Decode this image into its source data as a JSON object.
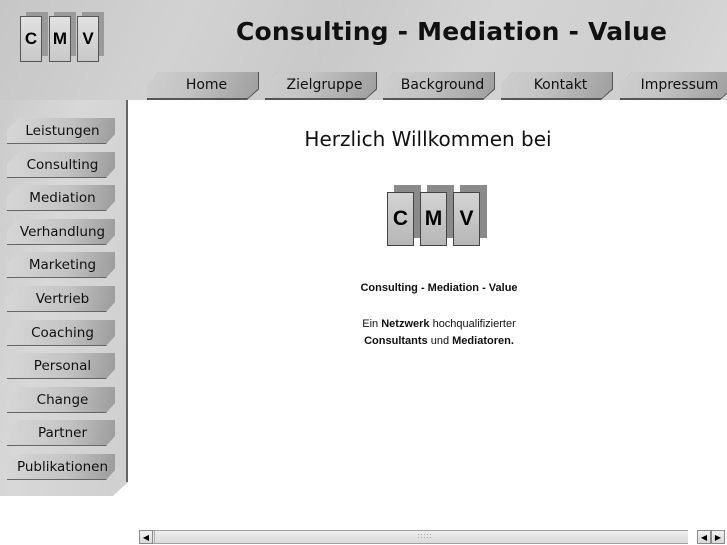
{
  "header": {
    "logo_letters": [
      "C",
      "M",
      "V"
    ],
    "title": "Consulting - Mediation - Value"
  },
  "top_nav": {
    "tabs": [
      {
        "label": "Home"
      },
      {
        "label": "Zielgruppe"
      },
      {
        "label": "Background"
      },
      {
        "label": "Kontakt"
      },
      {
        "label": "Impressum"
      }
    ]
  },
  "sidebar": {
    "items": [
      {
        "label": "Leistungen"
      },
      {
        "label": "Consulting"
      },
      {
        "label": "Mediation"
      },
      {
        "label": "Verhandlung"
      },
      {
        "label": "Marketing"
      },
      {
        "label": "Vertrieb"
      },
      {
        "label": "Coaching"
      },
      {
        "label": "Personal"
      },
      {
        "label": "Change"
      },
      {
        "label": "Partner"
      },
      {
        "label": "Publikationen"
      }
    ]
  },
  "main": {
    "welcome": "Herzlich Willkommen bei",
    "logo_letters": [
      "C",
      "M",
      "V"
    ],
    "tagline": "Consulting - Mediation - Value",
    "desc": {
      "part1": "Ein ",
      "bold1": "Netzwerk",
      "part2": " hochqualifizierter",
      "bold2": "Consultants",
      "part3": " und ",
      "bold3": "Mediatoren."
    }
  },
  "scrollbar": {
    "left_arrow": "◀",
    "right_arrow": "▶"
  }
}
